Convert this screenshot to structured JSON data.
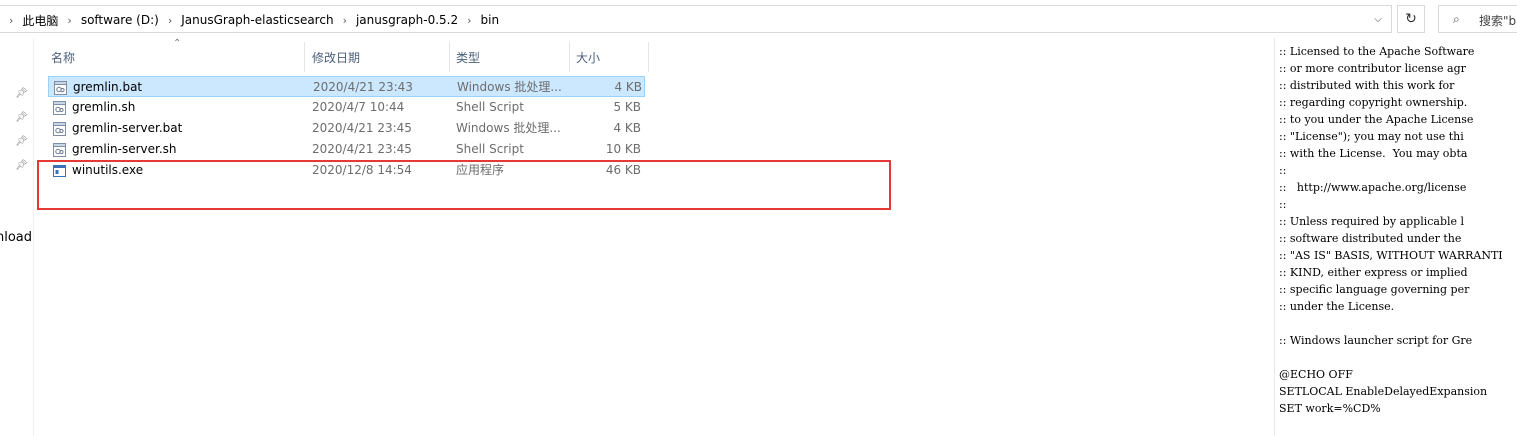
{
  "address": {
    "crumbs": [
      "此电脑",
      "software (D:)",
      "JanusGraph-elasticsearch",
      "janusgraph-0.5.2",
      "bin"
    ],
    "separator": "›",
    "dropdown_icon": "chevron-down-icon",
    "refresh_icon": "refresh-icon"
  },
  "search": {
    "placeholder": "搜索\"b",
    "icon": "search-icon"
  },
  "nav": {
    "partial_label": "nload",
    "pins": 4
  },
  "columns": {
    "name": "名称",
    "date": "修改日期",
    "type": "类型",
    "size": "大小"
  },
  "files": [
    {
      "name": "gremlin.bat",
      "date": "2020/4/21 23:43",
      "type": "Windows 批处理...",
      "size": "4 KB",
      "icon": "batch-file-icon",
      "selected": true
    },
    {
      "name": "gremlin.sh",
      "date": "2020/4/7 10:44",
      "type": "Shell Script",
      "size": "5 KB",
      "icon": "script-file-icon",
      "selected": false
    },
    {
      "name": "gremlin-server.bat",
      "date": "2020/4/21 23:45",
      "type": "Windows 批处理...",
      "size": "4 KB",
      "icon": "batch-file-icon",
      "selected": false
    },
    {
      "name": "gremlin-server.sh",
      "date": "2020/4/21 23:45",
      "type": "Shell Script",
      "size": "10 KB",
      "icon": "script-file-icon",
      "selected": false
    },
    {
      "name": "winutils.exe",
      "date": "2020/12/8 14:54",
      "type": "应用程序",
      "size": "46 KB",
      "icon": "exe-file-icon",
      "selected": false
    }
  ],
  "preview_lines": [
    ":: Licensed to the Apache Software",
    ":: or more contributor license agr",
    ":: distributed with this work for",
    ":: regarding copyright ownership.",
    ":: to you under the Apache License",
    ":: \"License\"); you may not use thi",
    ":: with the License.  You may obta",
    "::",
    "::   http://www.apache.org/license",
    "::",
    ":: Unless required by applicable l",
    ":: software distributed under the",
    ":: \"AS IS\" BASIS, WITHOUT WARRANTI",
    ":: KIND, either express or implied",
    ":: specific language governing per",
    ":: under the License.",
    "",
    ":: Windows launcher script for Gre",
    "",
    "@ECHO OFF",
    "SETLOCAL EnableDelayedExpansion",
    "SET work=%CD%"
  ],
  "colors": {
    "selection_bg": "#cce8ff",
    "selection_border": "#99d1ff",
    "annotation": "#e53935",
    "header_text": "#4c607a"
  }
}
